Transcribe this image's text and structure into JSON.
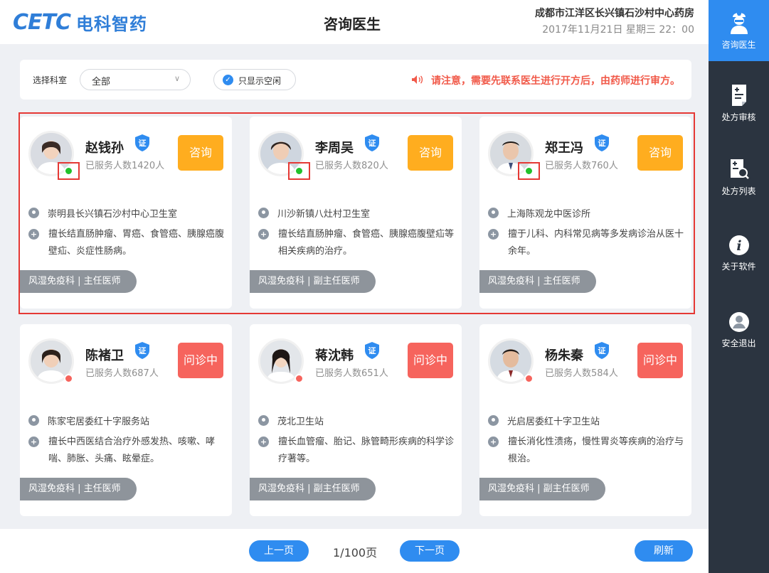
{
  "header": {
    "logo_mark": "CETC",
    "logo_text": "电科智药",
    "title": "咨询医生",
    "pharmacy_name": "成都市江洋区长兴镇石沙村中心药房",
    "datetime": "2017年11月21日  星期三  22：00"
  },
  "filter": {
    "label": "选择科室",
    "department_value": "全部",
    "only_idle_label": "只显示空闲",
    "notice": "请注意，需要先联系医生进行开方后，由药师进行审方。"
  },
  "doctors": [
    {
      "name": "赵钱孙",
      "served": "已服务人数1420人",
      "action": "咨询",
      "status": "online",
      "location": "崇明县长兴镇石沙村中心卫生室",
      "specialty": "擅长结直肠肿瘤、胃癌、食管癌、胰腺癌腹壁疝、炎症性肠病。",
      "tag": "风湿免疫科 | 主任医师"
    },
    {
      "name": "李周吴",
      "served": "已服务人数820人",
      "action": "咨询",
      "status": "online",
      "location": "川沙新镇八灶村卫生室",
      "specialty": "擅长结直肠肿瘤、食管癌、胰腺癌腹壁疝等相关疾病的治疗。",
      "tag": "风湿免疫科 | 副主任医师"
    },
    {
      "name": "郑王冯",
      "served": "已服务人数760人",
      "action": "咨询",
      "status": "online",
      "location": "上海陈观龙中医诊所",
      "specialty": "擅于儿科、内科常见病等多发病诊治从医十余年。",
      "tag": "风湿免疫科 | 主任医师"
    },
    {
      "name": "陈褚卫",
      "served": "已服务人数687人",
      "action": "问诊中",
      "status": "busy",
      "location": "陈家宅居委红十字服务站",
      "specialty": "擅长中西医结合治疗外感发热、咳嗽、哮喘、肺胀、头痛、眩晕症。",
      "tag": "风湿免疫科 | 主任医师"
    },
    {
      "name": "蒋沈韩",
      "served": "已服务人数651人",
      "action": "问诊中",
      "status": "busy",
      "location": "茂北卫生站",
      "specialty": "擅长血管瘤、胎记、脉管畸形疾病的科学诊疗著等。",
      "tag": "风湿免疫科 | 副主任医师"
    },
    {
      "name": "杨朱秦",
      "served": "已服务人数584人",
      "action": "问诊中",
      "status": "busy",
      "location": "光启居委红十字卫生站",
      "specialty": "擅长消化性溃疡，慢性胃炎等疾病的治疗与根治。",
      "tag": "风湿免疫科 | 副主任医师"
    }
  ],
  "pagination": {
    "prev": "上一页",
    "info": "1/100页",
    "next": "下一页",
    "refresh": "刷新"
  },
  "sidebar": {
    "items": [
      {
        "label": "咨询医生",
        "icon": "doctor-icon",
        "active": true
      },
      {
        "label": "处方审核",
        "icon": "prescription-review-icon"
      },
      {
        "label": "处方列表",
        "icon": "prescription-list-icon"
      },
      {
        "label": "关于软件",
        "icon": "info-icon"
      },
      {
        "label": "安全退出",
        "icon": "logout-user-icon"
      }
    ]
  },
  "colors": {
    "brand_blue": "#2f8cf0",
    "consult_orange": "#ffad1f",
    "busy_red": "#f6645d",
    "notice_red": "#f15a4a",
    "sidebar_bg": "#2b3440"
  }
}
